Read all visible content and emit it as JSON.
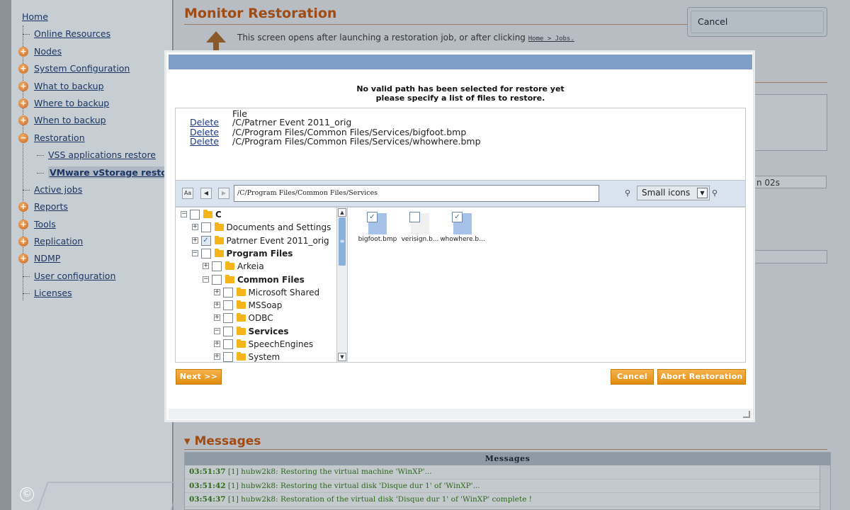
{
  "sidebar": {
    "items": [
      {
        "label": "Home",
        "kind": "root"
      },
      {
        "label": "Online Resources",
        "kind": "sub"
      },
      {
        "label": "Nodes",
        "kind": "bullet",
        "sym": "+"
      },
      {
        "label": "System Configuration",
        "kind": "bullet",
        "sym": "+"
      },
      {
        "label": "What to backup",
        "kind": "bullet",
        "sym": "+"
      },
      {
        "label": "Where to backup",
        "kind": "bullet",
        "sym": "+"
      },
      {
        "label": "When to backup",
        "kind": "bullet",
        "sym": "+"
      },
      {
        "label": "Restoration",
        "kind": "bullet",
        "sym": "−"
      },
      {
        "label": "VSS applications restore",
        "kind": "sub2"
      },
      {
        "label": "VMware vStorage restore",
        "kind": "sub2",
        "current": true
      },
      {
        "label": "Active jobs",
        "kind": "sub"
      },
      {
        "label": "Reports",
        "kind": "bullet",
        "sym": "+"
      },
      {
        "label": "Tools",
        "kind": "bullet",
        "sym": "+"
      },
      {
        "label": "Replication",
        "kind": "bullet",
        "sym": "+"
      },
      {
        "label": "NDMP",
        "kind": "bullet",
        "sym": "+"
      },
      {
        "label": "User configuration",
        "kind": "sub"
      },
      {
        "label": "Licenses",
        "kind": "sub"
      }
    ],
    "copyright": "©"
  },
  "page": {
    "title": "Monitor Restoration",
    "desc_pre": "This screen opens after launching a restoration job, or after clicking",
    "desc_link": "Home > Jobs.",
    "cancel_label": "Cancel",
    "elapsed_fragment": "n 02s"
  },
  "messages": {
    "heading": "▾ Messages",
    "panel_title": "Messages",
    "rows": [
      {
        "time": "03:51:37",
        "text": " [1] hubw2k8: Restoring the virtual machine 'WinXP'..."
      },
      {
        "time": "03:51:42",
        "text": " [1] hubw2k8: Restoring the virtual disk 'Disque dur 1' of 'WinXP'..."
      },
      {
        "time": "03:54:37",
        "text": " [1] hubw2k8: Restoration of the virtual disk 'Disque dur 1' of 'WinXP' complete !"
      }
    ]
  },
  "modal": {
    "message_line1": "No valid path has been selected for restore yet",
    "message_line2": "please specify a list of files to restore.",
    "file_header": "File",
    "delete_label": "Delete",
    "selected_files": [
      "/C/Patrner Event 2011_orig",
      "/C/Program Files/Common Files/Services/bigfoot.bmp",
      "/C/Program Files/Common Files/Services/whowhere.bmp"
    ],
    "path_value": "/C/Program Files/Common Files/Services",
    "case_button": "Aa",
    "view_mode": "Small icons",
    "tree": [
      {
        "label": "C",
        "level": 0,
        "exp": "−",
        "checked": false,
        "bold": true
      },
      {
        "label": "Documents and Settings",
        "level": 1,
        "exp": "+",
        "checked": false,
        "bold": false
      },
      {
        "label": "Patrner Event 2011_orig",
        "level": 1,
        "exp": "+",
        "checked": true,
        "bold": false
      },
      {
        "label": "Program Files",
        "level": 1,
        "exp": "−",
        "checked": false,
        "bold": true
      },
      {
        "label": "Arkeia",
        "level": 2,
        "exp": "+",
        "checked": false,
        "bold": false
      },
      {
        "label": "Common Files",
        "level": 2,
        "exp": "−",
        "checked": false,
        "bold": true
      },
      {
        "label": "Microsoft Shared",
        "level": 3,
        "exp": "+",
        "checked": false,
        "bold": false
      },
      {
        "label": "MSSoap",
        "level": 3,
        "exp": "+",
        "checked": false,
        "bold": false
      },
      {
        "label": "ODBC",
        "level": 3,
        "exp": "+",
        "checked": false,
        "bold": false
      },
      {
        "label": "Services",
        "level": 3,
        "exp": "−",
        "checked": false,
        "bold": true
      },
      {
        "label": "SpeechEngines",
        "level": 3,
        "exp": "+",
        "checked": false,
        "bold": false
      },
      {
        "label": "System",
        "level": 3,
        "exp": "+",
        "checked": false,
        "bold": false
      }
    ],
    "files": [
      {
        "name": "bigfoot.bmp",
        "checked": true,
        "thumb": "image"
      },
      {
        "name": "verisign.b...",
        "checked": false,
        "thumb": "plain"
      },
      {
        "name": "whowhere.b...",
        "checked": true,
        "thumb": "image"
      }
    ],
    "next_label": "Next >>",
    "cancel_label": "Cancel",
    "abort_label": "Abort Restoration"
  },
  "colors": {
    "accent_orange": "#e08d10",
    "title_brown": "#a04b14",
    "modal_header": "#7f9fc9",
    "message_green": "#2c6a1a"
  }
}
